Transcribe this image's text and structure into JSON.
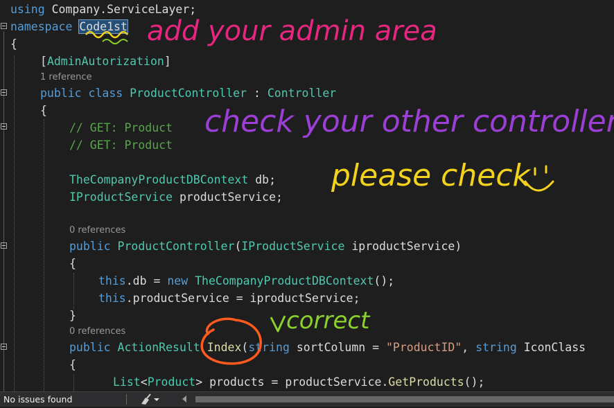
{
  "code": {
    "line_using_kw": "using",
    "line_using_ns": " Company.ServiceLayer;",
    "line_namespace_kw": "namespace",
    "line_namespace_name": "Code1st",
    "brace_open": "{",
    "brace_close": "}",
    "attribute": "AdminAutorization",
    "lens_class": "1 reference",
    "class_public": "public",
    "class_kw": "class",
    "class_name": "ProductController",
    "class_colon": " : ",
    "class_base": "Controller",
    "comment1": "// GET: Product",
    "comment2": "// GET: Product",
    "field1_type": "TheCompanyProductDBContext",
    "field1_name": " db;",
    "field2_type": "IProductService",
    "field2_name": " productService;",
    "lens_ctor": "0 references",
    "ctor_public": "public",
    "ctor_name": "ProductController",
    "ctor_open": "(",
    "ctor_param_type": "IProductService",
    "ctor_param_name": " iproductService)",
    "assign1_this": "this",
    "assign1_mid": ".db = ",
    "assign1_new": "new",
    "assign1_type": "TheCompanyProductDBContext",
    "assign1_end": "();",
    "assign2_this": "this",
    "assign2_rest": ".productService = iproductService;",
    "lens_index": "0 references",
    "index_public": "public",
    "index_type": "ActionResult",
    "index_name": "Index",
    "index_open": "(",
    "index_p1_type": "string",
    "index_p1_name": " sortColumn = ",
    "index_p1_value": "\"ProductID\"",
    "index_comma": ", ",
    "index_p2_type": "string",
    "index_p2_name": " IconClass",
    "list_type": "List",
    "list_lt": "<",
    "list_generic": "Product",
    "list_rest": "> products = productService.",
    "list_method": "GetProducts",
    "list_end": "();"
  },
  "annotations": {
    "admin_area": "add your admin area",
    "check_controllers": "check your other controllers",
    "please_check": "please check",
    "correct": "correct"
  },
  "status_bar": {
    "issues": "No issues found"
  },
  "colors": {
    "keyword": "#569cd6",
    "type": "#4ec9b0",
    "comment": "#57a64a",
    "string": "#d69d85",
    "method": "#dcdcaa",
    "ink_pink": "#e6267f",
    "ink_purple": "#9b3fd6",
    "ink_yellow": "#f2d21c",
    "ink_green": "#8bd12b",
    "ink_orange": "#ff5a1f"
  }
}
